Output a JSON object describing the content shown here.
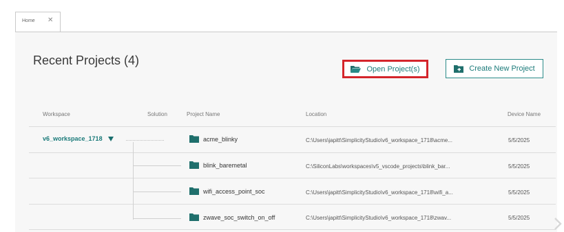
{
  "tabs": [
    {
      "label": "Home",
      "close": "✕"
    }
  ],
  "page": {
    "title": "Recent Projects (4)"
  },
  "buttons": {
    "open": "Open Project(s)",
    "create": "Create New Project"
  },
  "columns": [
    "Workspace",
    "Solution",
    "Project Name",
    "Location",
    "Device Name"
  ],
  "workspace": {
    "name": "v6_workspace_1718"
  },
  "rows": [
    {
      "project": "acme_blinky",
      "location": "C:\\Users\\japitt\\SimplicityStudio\\v6_workspace_1718\\acme...",
      "device": "5/5/2025"
    },
    {
      "project": "blink_baremetal",
      "location": "C:\\SiliconLabs\\workspaces\\v5_vscode_projects\\blink_bar...",
      "device": "5/5/2025"
    },
    {
      "project": "wifi_access_point_soc",
      "location": "C:\\Users\\japitt\\SimplicityStudio\\v6_workspace_1718\\wifi_a...",
      "device": "5/5/2025"
    },
    {
      "project": "zwave_soc_switch_on_off",
      "location": "C:\\Users\\japitt\\SimplicityStudio\\v6_workspace_1718\\zwav...",
      "device": "5/5/2025"
    }
  ],
  "colors": {
    "accent": "#1a7a79",
    "highlight": "#d4252b",
    "folder": "#1f6f6c"
  },
  "icons": {
    "open": "open-folder-icon",
    "create": "new-project-icon",
    "row": "folder-icon",
    "expand": "caret-down-icon"
  }
}
